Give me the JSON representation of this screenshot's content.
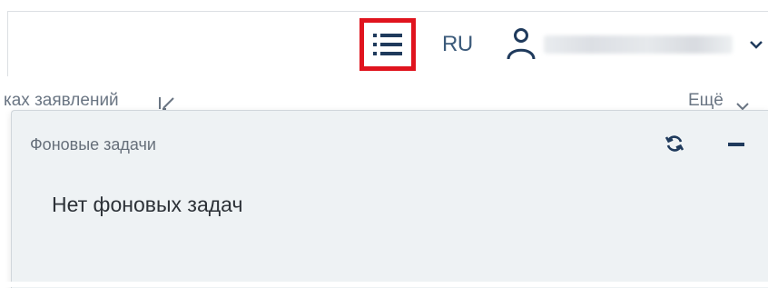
{
  "header": {
    "tasks_button_icon": "list-icon",
    "language": "RU",
    "user_icon": "user-icon",
    "user_menu_icon": "chevron-down-icon",
    "highlight_color": "#e0141e",
    "accent_color": "#1f3a5c"
  },
  "toolbar": {
    "breadcrumb_tail": "каx заявлений",
    "edit_icon": "pencil-icon",
    "more_label": "Ещё"
  },
  "background_tasks": {
    "title": "Фоновые задачи",
    "refresh_icon": "refresh-icon",
    "minimize_icon": "minimize-icon",
    "empty_message": "Нет фоновых задач"
  }
}
